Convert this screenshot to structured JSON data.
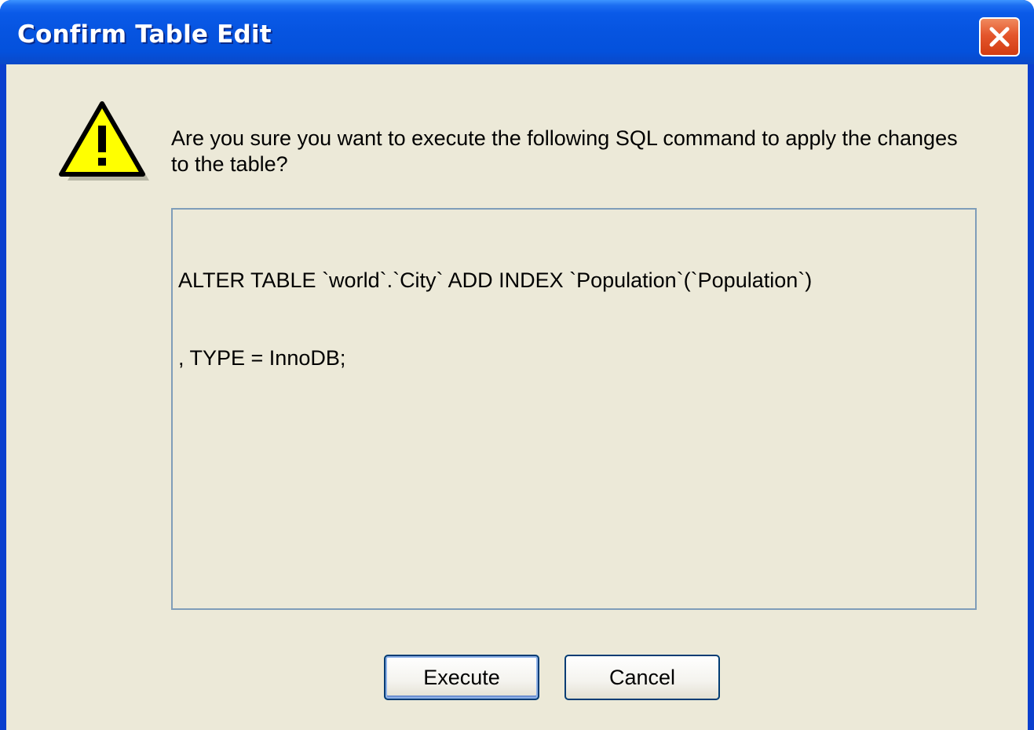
{
  "window": {
    "title": "Confirm Table Edit",
    "close_icon": "close-x-icon"
  },
  "dialog": {
    "icon": "warning-icon",
    "message": "Are you sure you want to execute the following SQL command to apply the changes to the table?",
    "sql_lines": [
      "ALTER TABLE `world`.`City` ADD INDEX `Population`(`Population`)",
      ", TYPE = InnoDB;"
    ]
  },
  "buttons": {
    "execute_label": "Execute",
    "cancel_label": "Cancel"
  },
  "colors": {
    "titlebar": "#0654e0",
    "client_bg": "#ece9d8",
    "close_button": "#e4562c",
    "warning_fill": "#ffff00"
  }
}
